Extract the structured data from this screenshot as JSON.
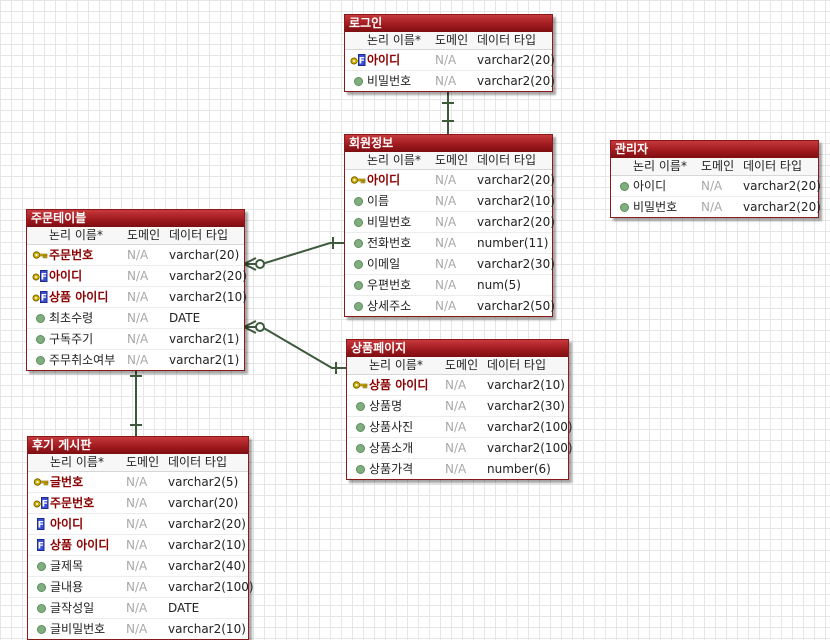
{
  "headers": {
    "name": "논리 이름",
    "domain": "도메인",
    "type": "데이터 타입"
  },
  "entities": {
    "login": {
      "title": "로그인",
      "rows": [
        {
          "name": "아이디",
          "domain": "N/A",
          "type": "varchar2(20)",
          "icon": "primary-foreign-key-icon",
          "key": true
        },
        {
          "name": "비밀번호",
          "domain": "N/A",
          "type": "varchar2(20)",
          "icon": "attribute-dot-icon",
          "key": false
        }
      ]
    },
    "member": {
      "title": "회원정보",
      "rows": [
        {
          "name": "아이디",
          "domain": "N/A",
          "type": "varchar2(20)",
          "icon": "primary-key-icon",
          "key": true
        },
        {
          "name": "이름",
          "domain": "N/A",
          "type": "varchar2(10)",
          "icon": "attribute-dot-icon",
          "key": false
        },
        {
          "name": "비밀번호",
          "domain": "N/A",
          "type": "varchar2(20)",
          "icon": "attribute-dot-icon",
          "key": false
        },
        {
          "name": "전화번호",
          "domain": "N/A",
          "type": "number(11)",
          "icon": "attribute-dot-icon",
          "key": false
        },
        {
          "name": "이메일",
          "domain": "N/A",
          "type": "varchar2(30)",
          "icon": "attribute-dot-icon",
          "key": false
        },
        {
          "name": "우편번호",
          "domain": "N/A",
          "type": "num(5)",
          "icon": "attribute-dot-icon",
          "key": false
        },
        {
          "name": "상세주소",
          "domain": "N/A",
          "type": "varchar2(50)",
          "icon": "attribute-dot-icon",
          "key": false
        }
      ]
    },
    "admin": {
      "title": "관리자",
      "rows": [
        {
          "name": "아이디",
          "domain": "N/A",
          "type": "varchar2(20)",
          "icon": "attribute-dot-icon",
          "key": false
        },
        {
          "name": "비밀번호",
          "domain": "N/A",
          "type": "varchar2(20)",
          "icon": "attribute-dot-icon",
          "key": false
        }
      ]
    },
    "order": {
      "title": "주문테이블",
      "rows": [
        {
          "name": "주문번호",
          "domain": "N/A",
          "type": "varchar(20)",
          "icon": "primary-key-icon",
          "key": true
        },
        {
          "name": "아이디",
          "domain": "N/A",
          "type": "varchar2(20)",
          "icon": "primary-foreign-key-icon",
          "key": true
        },
        {
          "name": "상품 아이디",
          "domain": "N/A",
          "type": "varchar2(10)",
          "icon": "primary-foreign-key-icon",
          "key": true
        },
        {
          "name": "최초수령",
          "domain": "N/A",
          "type": "DATE",
          "icon": "attribute-dot-icon",
          "key": false
        },
        {
          "name": "구독주기",
          "domain": "N/A",
          "type": "varchar2(1)",
          "icon": "attribute-dot-icon",
          "key": false
        },
        {
          "name": "주무취소여부",
          "domain": "N/A",
          "type": "varchar2(1)",
          "icon": "attribute-dot-icon",
          "key": false
        }
      ]
    },
    "product": {
      "title": "상품페이지",
      "rows": [
        {
          "name": "상품 아이디",
          "domain": "N/A",
          "type": "varchar2(10)",
          "icon": "primary-key-icon",
          "key": true
        },
        {
          "name": "상품명",
          "domain": "N/A",
          "type": "varchar2(30)",
          "icon": "attribute-dot-icon",
          "key": false
        },
        {
          "name": "상품사진",
          "domain": "N/A",
          "type": "varchar2(100)",
          "icon": "attribute-dot-icon",
          "key": false
        },
        {
          "name": "상품소개",
          "domain": "N/A",
          "type": "varchar2(100)",
          "icon": "attribute-dot-icon",
          "key": false
        },
        {
          "name": "상품가격",
          "domain": "N/A",
          "type": "number(6)",
          "icon": "attribute-dot-icon",
          "key": false
        }
      ]
    },
    "review": {
      "title": "후기 게시판",
      "rows": [
        {
          "name": "글번호",
          "domain": "N/A",
          "type": "varchar2(5)",
          "icon": "primary-key-icon",
          "key": true
        },
        {
          "name": "주문번호",
          "domain": "N/A",
          "type": "varchar(20)",
          "icon": "primary-foreign-key-icon",
          "key": true
        },
        {
          "name": "아이디",
          "domain": "N/A",
          "type": "varchar2(20)",
          "icon": "foreign-key-icon",
          "key": true
        },
        {
          "name": "상품 아이디",
          "domain": "N/A",
          "type": "varchar2(10)",
          "icon": "foreign-key-icon",
          "key": true
        },
        {
          "name": "글제목",
          "domain": "N/A",
          "type": "varchar2(40)",
          "icon": "attribute-dot-icon",
          "key": false
        },
        {
          "name": "글내용",
          "domain": "N/A",
          "type": "varchar2(100)",
          "icon": "attribute-dot-icon",
          "key": false
        },
        {
          "name": "글작성일",
          "domain": "N/A",
          "type": "DATE",
          "icon": "attribute-dot-icon",
          "key": false
        },
        {
          "name": "글비밀번호",
          "domain": "N/A",
          "type": "varchar2(10)",
          "icon": "attribute-dot-icon",
          "key": false
        }
      ]
    }
  },
  "colors": {
    "title_bar": "#a01b1f",
    "key_text": "#8b0000",
    "connector": "#3d5a3d",
    "attribute_dot": "#7fae7f",
    "key_icon": "#d4b200",
    "fk_icon": "#3a4fd4"
  }
}
